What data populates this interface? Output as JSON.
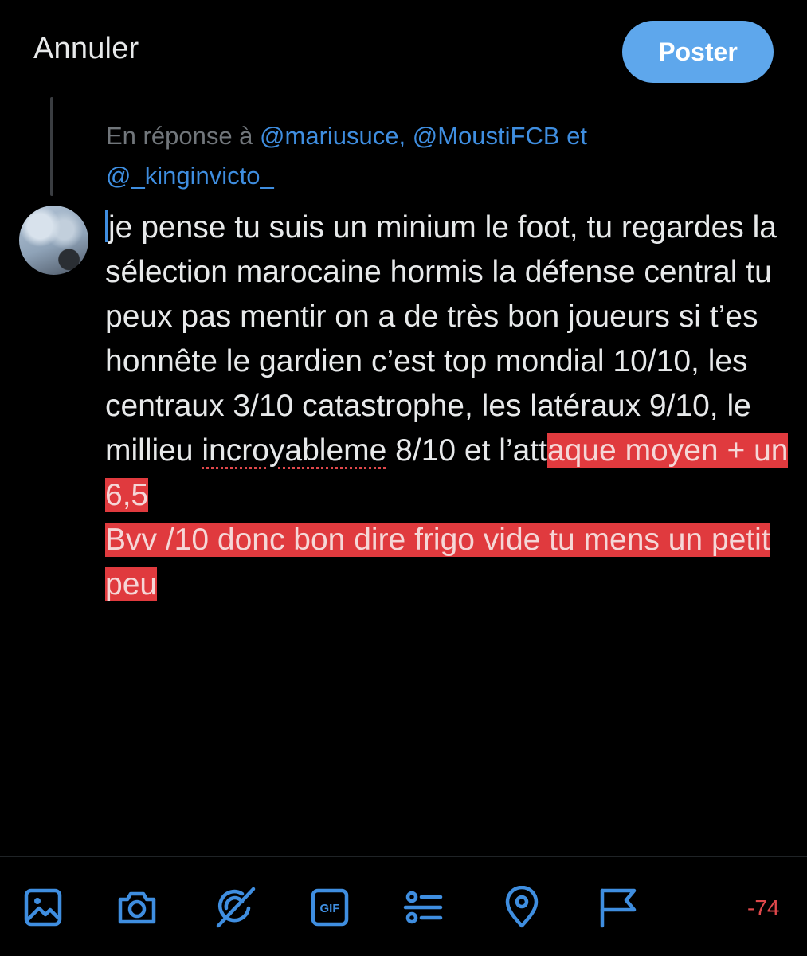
{
  "header": {
    "cancel_label": "Annuler",
    "post_label": "Poster"
  },
  "reply": {
    "prefix": "En réponse à",
    "mention_1": "@mariusuce,",
    "mention_2": "@MoustiFCB",
    "conjunction": "et",
    "mention_3": "@_kinginvicto_"
  },
  "compose": {
    "text_normal": "je pense tu suis un minium le foot, tu regardes la sélection marocaine hormis la défense central tu peux pas mentir on a de très bon joueurs si t’es honnête le gardien c’est top mondial 10/10, les centraux 3/10 catastrophe, les latéraux 9/10, le millieu ",
    "misspelled_word": "incroyableme",
    "text_after_misspelled": " 8/10 et l’att",
    "text_overflow_1": "aque moyen + un 6,5",
    "text_overflow_2": "Bvv /10 donc bon dire frigo vide tu mens un petit peu"
  },
  "toolbar": {
    "icons": [
      "image-icon",
      "camera-icon",
      "grok-icon",
      "gif-icon",
      "poll-icon",
      "location-icon",
      "flag-icon"
    ],
    "gif_label": "GIF",
    "char_counter": "-74"
  },
  "colors": {
    "accent": "#5ea7ec",
    "mention": "#3f8ee0",
    "overflow_highlight": "#e03a3e",
    "counter": "#e0484b"
  }
}
